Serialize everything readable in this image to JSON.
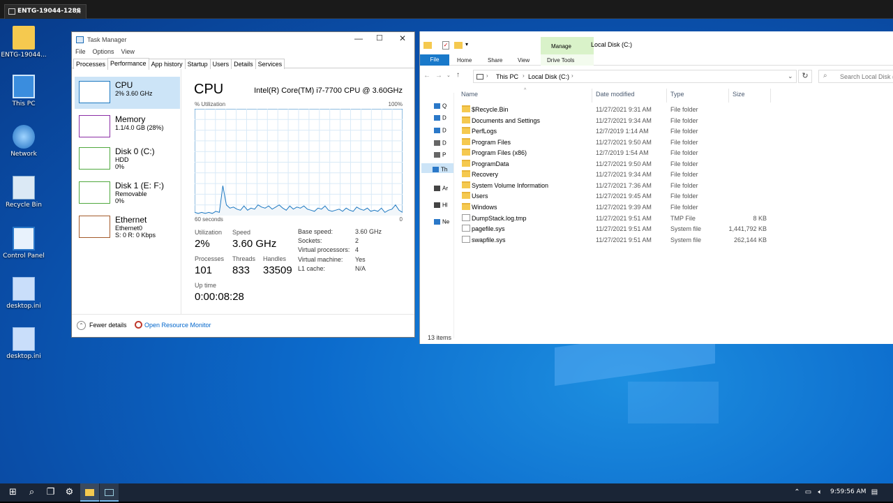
{
  "session_tab": {
    "label": "ENTG-19044-1288",
    "close": "✕"
  },
  "desktop_icons": [
    {
      "label": "ENTG-19044...",
      "icon": "user-folder-icon"
    },
    {
      "label": "This PC",
      "icon": "computer-icon"
    },
    {
      "label": "Network",
      "icon": "network-icon"
    },
    {
      "label": "Recycle Bin",
      "icon": "recycle-bin-icon"
    },
    {
      "label": "Control Panel",
      "icon": "control-panel-icon"
    },
    {
      "label": "desktop.ini",
      "icon": "file-icon"
    },
    {
      "label": "desktop.ini",
      "icon": "file-icon"
    }
  ],
  "task_manager": {
    "title": "Task Manager",
    "menu": [
      "File",
      "Options",
      "View"
    ],
    "tabs": [
      "Processes",
      "Performance",
      "App history",
      "Startup",
      "Users",
      "Details",
      "Services"
    ],
    "active_tab": "Performance",
    "sidebar": [
      {
        "name": "CPU",
        "line1": "2% 3.60 GHz",
        "line2": "",
        "color": "#1d78c1"
      },
      {
        "name": "Memory",
        "line1": "1.1/4.0 GB (28%)",
        "line2": "",
        "color": "#8b2da5"
      },
      {
        "name": "Disk 0 (C:)",
        "line1": "HDD",
        "line2": "0%",
        "color": "#4fa83d"
      },
      {
        "name": "Disk 1 (E: F:)",
        "line1": "Removable",
        "line2": "0%",
        "color": "#4fa83d"
      },
      {
        "name": "Ethernet",
        "line1": "Ethernet0",
        "line2": "S: 0 R: 0 Kbps",
        "color": "#a45a2a"
      }
    ],
    "cpu": {
      "heading": "CPU",
      "model": "Intel(R) Core(TM) i7-7700 CPU @ 3.60GHz",
      "utilization_label": "% Utilization",
      "max_label": "100%",
      "time_label": "60 seconds",
      "zero_label": "0",
      "stats": {
        "utilization_label": "Utilization",
        "utilization": "2%",
        "speed_label": "Speed",
        "speed": "3.60 GHz",
        "processes_label": "Processes",
        "processes": "101",
        "threads_label": "Threads",
        "threads": "833",
        "handles_label": "Handles",
        "handles": "33509",
        "uptime_label": "Up time",
        "uptime": "0:00:08:28"
      },
      "details": [
        {
          "k": "Base speed:",
          "v": "3.60 GHz"
        },
        {
          "k": "Sockets:",
          "v": "2"
        },
        {
          "k": "Virtual processors:",
          "v": "4"
        },
        {
          "k": "Virtual machine:",
          "v": "Yes"
        },
        {
          "k": "L1 cache:",
          "v": "N/A"
        }
      ],
      "graph_values": [
        3,
        2,
        3,
        2,
        3,
        2,
        4,
        3,
        28,
        10,
        7,
        8,
        6,
        5,
        9,
        5,
        7,
        6,
        10,
        8,
        7,
        9,
        6,
        8,
        10,
        7,
        5,
        9,
        6,
        8,
        7,
        9,
        6,
        5,
        4,
        7,
        6,
        9,
        5,
        4,
        5,
        6,
        4,
        7,
        5,
        4,
        8,
        6,
        5,
        7,
        4,
        5,
        4,
        7,
        3,
        5,
        6,
        10,
        5,
        3
      ]
    },
    "footer": {
      "fewer": "Fewer details",
      "monitor": "Open Resource Monitor"
    }
  },
  "explorer": {
    "title": "Local Disk (C:)",
    "ribbon_tabs": [
      "File",
      "Home",
      "Share",
      "View"
    ],
    "manage_label": "Manage",
    "drive_tools": "Drive Tools",
    "breadcrumb": [
      "This PC",
      "Local Disk (C:)"
    ],
    "search_placeholder": "Search Local Disk (C:)",
    "columns": [
      "Name",
      "Date modified",
      "Type",
      "Size"
    ],
    "nav_letters": [
      "Q",
      "D",
      "D",
      "D",
      "P",
      "Th",
      "Ar",
      "Hl",
      "Ne"
    ],
    "files": [
      {
        "name": "$Recycle.Bin",
        "date": "11/27/2021 9:31 AM",
        "type": "File folder",
        "size": "",
        "kind": "folder"
      },
      {
        "name": "Documents and Settings",
        "date": "11/27/2021 9:34 AM",
        "type": "File folder",
        "size": "",
        "kind": "link"
      },
      {
        "name": "PerfLogs",
        "date": "12/7/2019 1:14 AM",
        "type": "File folder",
        "size": "",
        "kind": "folder"
      },
      {
        "name": "Program Files",
        "date": "11/27/2021 9:50 AM",
        "type": "File folder",
        "size": "",
        "kind": "folder"
      },
      {
        "name": "Program Files (x86)",
        "date": "12/7/2019 1:54 AM",
        "type": "File folder",
        "size": "",
        "kind": "folder"
      },
      {
        "name": "ProgramData",
        "date": "11/27/2021 9:50 AM",
        "type": "File folder",
        "size": "",
        "kind": "folder"
      },
      {
        "name": "Recovery",
        "date": "11/27/2021 9:34 AM",
        "type": "File folder",
        "size": "",
        "kind": "folder"
      },
      {
        "name": "System Volume Information",
        "date": "11/27/2021 7:36 AM",
        "type": "File folder",
        "size": "",
        "kind": "folder"
      },
      {
        "name": "Users",
        "date": "11/27/2021 9:45 AM",
        "type": "File folder",
        "size": "",
        "kind": "folder"
      },
      {
        "name": "Windows",
        "date": "11/27/2021 9:39 AM",
        "type": "File folder",
        "size": "",
        "kind": "folder"
      },
      {
        "name": "DumpStack.log.tmp",
        "date": "11/27/2021 9:51 AM",
        "type": "TMP File",
        "size": "8 KB",
        "kind": "file"
      },
      {
        "name": "pagefile.sys",
        "date": "11/27/2021 9:51 AM",
        "type": "System file",
        "size": "1,441,792 KB",
        "kind": "file"
      },
      {
        "name": "swapfile.sys",
        "date": "11/27/2021 9:51 AM",
        "type": "System file",
        "size": "262,144 KB",
        "kind": "file"
      }
    ],
    "status": "13 items"
  },
  "taskbar": {
    "clock": "9:59:56 AM"
  }
}
